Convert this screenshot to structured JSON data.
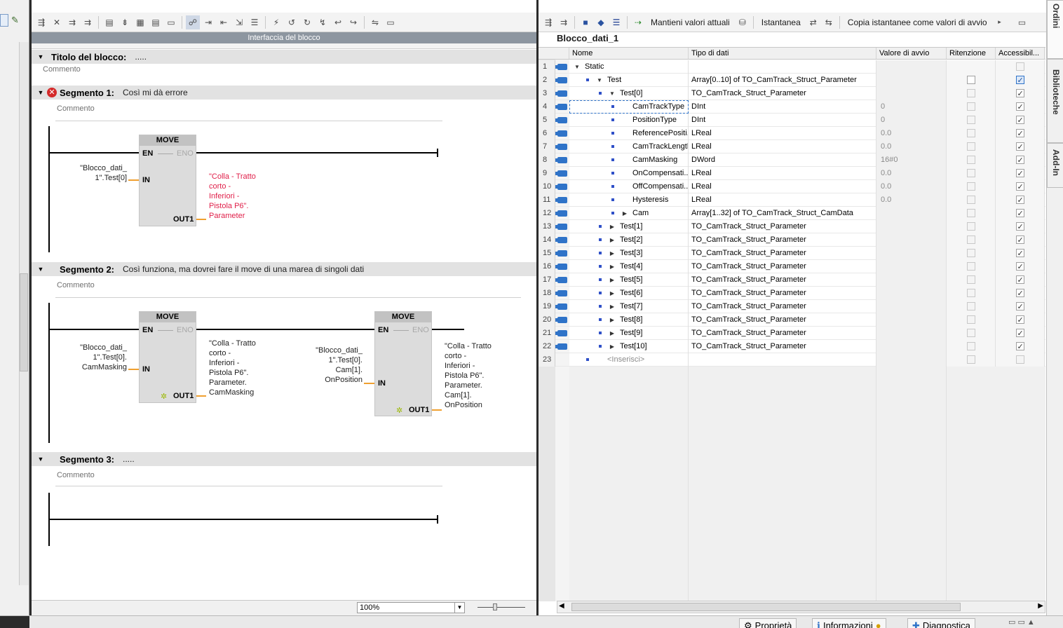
{
  "lad_editor": {
    "toolbar_icons": [
      "insert-network-icon",
      "delete-network-icon",
      "insert-row-icon",
      "add-row-icon",
      "insert-box-icon",
      "insert-coil-icon",
      "open-network-icon",
      "close-network-icon",
      "absolute-symbolic-icon",
      "comment-icon",
      "next-error-icon",
      "prev-error-icon",
      "goto-icon",
      "show-favorites-icon",
      "monitor-icon",
      "compare-icon",
      "download-icon",
      "upload-icon",
      "mark-icon",
      "unmark-icon",
      "refresh-icon",
      "help-icon"
    ],
    "interface_bar_label": "Interfaccia del blocco",
    "block_title_label": "Titolo del blocco:",
    "block_title_value": ".....",
    "block_comment": "Commento",
    "zoom": "100%",
    "segments": [
      {
        "label": "Segmento 1:",
        "description": "Così mi dà errore",
        "has_error": true,
        "comment": "Commento",
        "boxes": [
          {
            "name": "MOVE",
            "en": "EN",
            "eno": "ENO",
            "in": "IN",
            "out": "OUT1",
            "in_operand": [
              "\"Blocco_dati_",
              "1\".Test[0]"
            ],
            "out_operand": [
              "\"Colla - Tratto",
              "corto -",
              "Inferiori -",
              "Pistola P6\".",
              "Parameter"
            ],
            "out_operand_error": true
          }
        ]
      },
      {
        "label": "Segmento 2:",
        "description": "Così funziona, ma dovrei fare il move di una marea di singoli dati",
        "has_error": false,
        "comment": "Commento",
        "boxes": [
          {
            "name": "MOVE",
            "en": "EN",
            "eno": "ENO",
            "in": "IN",
            "out": "OUT1",
            "in_operand": [
              "\"Blocco_dati_",
              "1\".Test[0].",
              "CamMasking"
            ],
            "out_operand": [
              "\"Colla - Tratto",
              "corto -",
              "Inferiori -",
              "Pistola P6\".",
              "Parameter.",
              "CamMasking"
            ],
            "out_operand_error": false
          },
          {
            "name": "MOVE",
            "en": "EN",
            "eno": "ENO",
            "in": "IN",
            "out": "OUT1",
            "in_operand": [
              "\"Blocco_dati_",
              "1\".Test[0].",
              "Cam[1].",
              "OnPosition"
            ],
            "out_operand": [
              "\"Colla - Tratto",
              "corto -",
              "Inferiori -",
              "Pistola P6\".",
              "Parameter.",
              "Cam[1].",
              "OnPosition"
            ],
            "out_operand_error": false
          }
        ]
      },
      {
        "label": "Segmento 3:",
        "description": ".....",
        "has_error": false,
        "comment": "Commento",
        "boxes": []
      }
    ]
  },
  "db_editor": {
    "toolbar": {
      "keep_actual_values": "Mantieni valori attuali",
      "snapshot": "Istantanea",
      "copy_snapshot": "Copia istantanee come valori di avvio"
    },
    "title": "Blocco_dati_1",
    "columns": [
      "Nome",
      "Tipo di dati",
      "Valore di avvio",
      "Ritenzione",
      "Accessibil..."
    ],
    "rows": [
      {
        "num": "1",
        "level": 0,
        "expander": "down",
        "name": "Static",
        "type": "",
        "start": "",
        "retain": "none",
        "access": "dis",
        "bullet": false
      },
      {
        "num": "2",
        "level": 1,
        "expander": "down",
        "name": "Test",
        "type": "Array[0..10] of TO_CamTrack_Struct_Parameter",
        "start": "",
        "retain": "empty",
        "access": "blue",
        "bullet": true
      },
      {
        "num": "3",
        "level": 2,
        "expander": "down",
        "name": "Test[0]",
        "type": "TO_CamTrack_Struct_Parameter",
        "start": "",
        "retain": "dis",
        "access": "chk",
        "bullet": true
      },
      {
        "num": "4",
        "level": 3,
        "expander": "",
        "name": "CamTrackType",
        "type": "DInt",
        "start": "0",
        "retain": "dis",
        "access": "chk",
        "bullet": true,
        "selected": true
      },
      {
        "num": "5",
        "level": 3,
        "expander": "",
        "name": "PositionType",
        "type": "DInt",
        "start": "0",
        "retain": "dis",
        "access": "chk",
        "bullet": true
      },
      {
        "num": "6",
        "level": 3,
        "expander": "",
        "name": "ReferencePositi...",
        "type": "LReal",
        "start": "0.0",
        "retain": "dis",
        "access": "chk",
        "bullet": true
      },
      {
        "num": "7",
        "level": 3,
        "expander": "",
        "name": "CamTrackLength",
        "type": "LReal",
        "start": "0.0",
        "retain": "dis",
        "access": "chk",
        "bullet": true
      },
      {
        "num": "8",
        "level": 3,
        "expander": "",
        "name": "CamMasking",
        "type": "DWord",
        "start": "16#0",
        "retain": "dis",
        "access": "chk",
        "bullet": true
      },
      {
        "num": "9",
        "level": 3,
        "expander": "",
        "name": "OnCompensati...",
        "type": "LReal",
        "start": "0.0",
        "retain": "dis",
        "access": "chk",
        "bullet": true
      },
      {
        "num": "10",
        "level": 3,
        "expander": "",
        "name": "OffCompensati...",
        "type": "LReal",
        "start": "0.0",
        "retain": "dis",
        "access": "chk",
        "bullet": true
      },
      {
        "num": "11",
        "level": 3,
        "expander": "",
        "name": "Hysteresis",
        "type": "LReal",
        "start": "0.0",
        "retain": "dis",
        "access": "chk",
        "bullet": true
      },
      {
        "num": "12",
        "level": 3,
        "expander": "right",
        "name": "Cam",
        "type": "Array[1..32] of TO_CamTrack_Struct_CamData",
        "start": "",
        "retain": "dis",
        "access": "chk",
        "bullet": true
      },
      {
        "num": "13",
        "level": 2,
        "expander": "right",
        "name": "Test[1]",
        "type": "TO_CamTrack_Struct_Parameter",
        "start": "",
        "retain": "dis",
        "access": "chk",
        "bullet": true
      },
      {
        "num": "14",
        "level": 2,
        "expander": "right",
        "name": "Test[2]",
        "type": "TO_CamTrack_Struct_Parameter",
        "start": "",
        "retain": "dis",
        "access": "chk",
        "bullet": true
      },
      {
        "num": "15",
        "level": 2,
        "expander": "right",
        "name": "Test[3]",
        "type": "TO_CamTrack_Struct_Parameter",
        "start": "",
        "retain": "dis",
        "access": "chk",
        "bullet": true
      },
      {
        "num": "16",
        "level": 2,
        "expander": "right",
        "name": "Test[4]",
        "type": "TO_CamTrack_Struct_Parameter",
        "start": "",
        "retain": "dis",
        "access": "chk",
        "bullet": true
      },
      {
        "num": "17",
        "level": 2,
        "expander": "right",
        "name": "Test[5]",
        "type": "TO_CamTrack_Struct_Parameter",
        "start": "",
        "retain": "dis",
        "access": "chk",
        "bullet": true
      },
      {
        "num": "18",
        "level": 2,
        "expander": "right",
        "name": "Test[6]",
        "type": "TO_CamTrack_Struct_Parameter",
        "start": "",
        "retain": "dis",
        "access": "chk",
        "bullet": true
      },
      {
        "num": "19",
        "level": 2,
        "expander": "right",
        "name": "Test[7]",
        "type": "TO_CamTrack_Struct_Parameter",
        "start": "",
        "retain": "dis",
        "access": "chk",
        "bullet": true
      },
      {
        "num": "20",
        "level": 2,
        "expander": "right",
        "name": "Test[8]",
        "type": "TO_CamTrack_Struct_Parameter",
        "start": "",
        "retain": "dis",
        "access": "chk",
        "bullet": true
      },
      {
        "num": "21",
        "level": 2,
        "expander": "right",
        "name": "Test[9]",
        "type": "TO_CamTrack_Struct_Parameter",
        "start": "",
        "retain": "dis",
        "access": "chk",
        "bullet": true
      },
      {
        "num": "22",
        "level": 2,
        "expander": "right",
        "name": "Test[10]",
        "type": "TO_CamTrack_Struct_Parameter",
        "start": "",
        "retain": "dis",
        "access": "chk",
        "bullet": true
      },
      {
        "num": "23",
        "level": 1,
        "expander": "",
        "name": "<Inserisci>",
        "type": "",
        "start": "",
        "retain": "dis",
        "access": "dis",
        "bullet": true,
        "placeholder": true
      }
    ]
  },
  "sidebar_tabs": [
    "Ordini",
    "Biblioteche",
    "Add-In"
  ],
  "bottom_tabs": [
    "Proprietà",
    "Informazioni",
    "Diagnostica"
  ],
  "colors": {
    "error": "#e0204a",
    "wire_orange": "#f0a030",
    "interface_blue": "#2f73c8",
    "header_grey": "#e2e2e2"
  }
}
